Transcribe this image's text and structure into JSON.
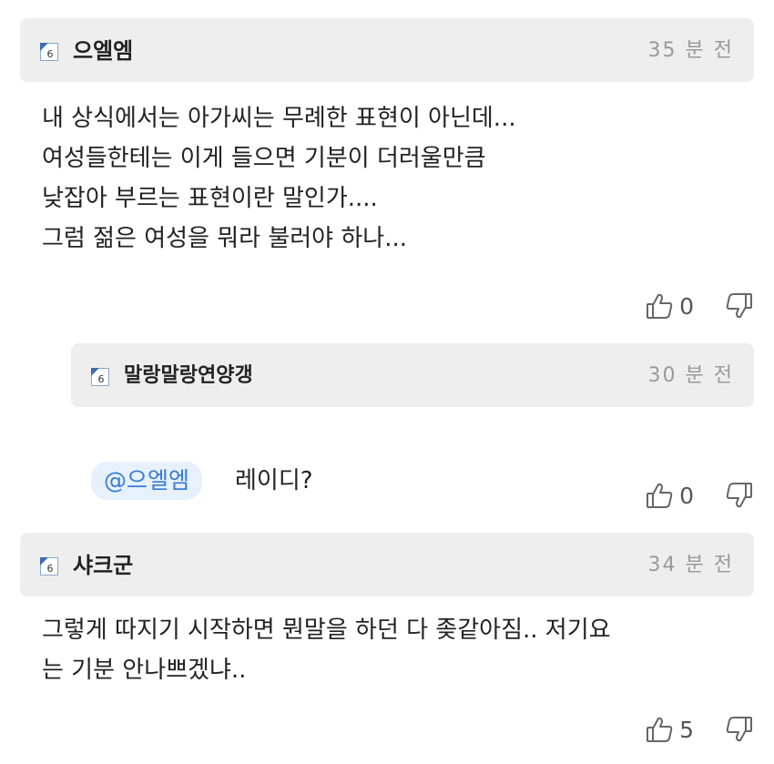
{
  "comments": [
    {
      "level": "6",
      "nickname": "으엘엠",
      "time": "35 분 전",
      "text": "내 상식에서는 아가씨는 무례한 표현이 아닌데...\n여성들한테는 이게 들으면 기분이 더러울만큼\n낮잡아 부르는 표현이란 말인가....\n그럼 젊은 여성을 뭐라 불러야 하나...",
      "likes": "0"
    },
    {
      "level": "6",
      "nickname": "말랑말랑연양갱",
      "time": "30 분 전",
      "mention": "@으엘엠",
      "text": "레이디?",
      "likes": "0"
    },
    {
      "level": "6",
      "nickname": "샤크군",
      "time": "34 분 전",
      "text": "그렇게 따지기 시작하면 뭔말을 하던 다 좆같아짐.. 저기요\n는 기분 안나쁘겠냐..",
      "likes": "5"
    }
  ],
  "colors": {
    "header_bg": "#eeeeee",
    "mention_bg": "#e6f1fb",
    "mention_text": "#3a7bd5",
    "time_text": "#9a9a9a"
  },
  "icons": [
    "level-badge-icon",
    "thumbs-up-icon",
    "thumbs-down-icon"
  ]
}
